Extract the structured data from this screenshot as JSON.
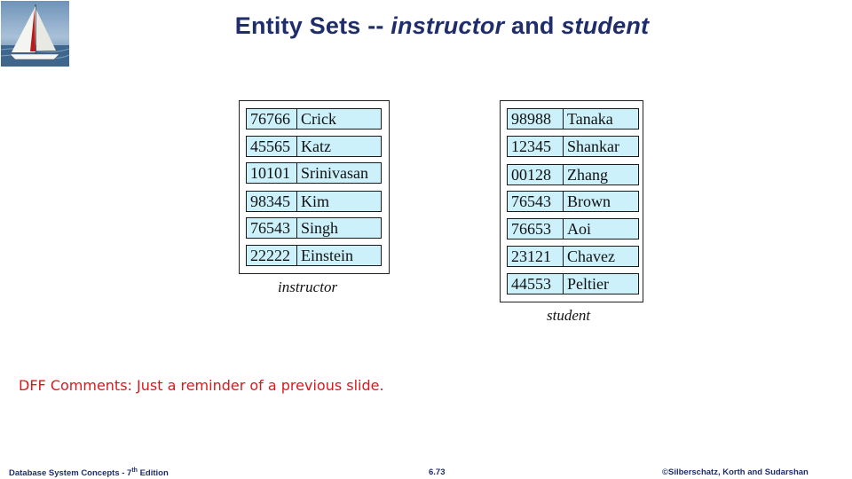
{
  "title": {
    "main": "Entity Sets --",
    "set1": "instructor",
    "and": "and",
    "set2": "student"
  },
  "instructor": {
    "caption": "instructor",
    "rows": [
      {
        "id": "76766",
        "name": "Crick"
      },
      {
        "id": "45565",
        "name": "Katz"
      },
      {
        "id": "10101",
        "name": "Srinivasan"
      },
      {
        "id": "98345",
        "name": "Kim"
      },
      {
        "id": "76543",
        "name": "Singh"
      },
      {
        "id": "22222",
        "name": "Einstein"
      }
    ]
  },
  "student": {
    "caption": "student",
    "rows": [
      {
        "id": "98988",
        "name": "Tanaka"
      },
      {
        "id": "12345",
        "name": "Shankar"
      },
      {
        "id": "00128",
        "name": "Zhang"
      },
      {
        "id": "76543",
        "name": "Brown"
      },
      {
        "id": "76653",
        "name": "Aoi"
      },
      {
        "id": "23121",
        "name": "Chavez"
      },
      {
        "id": "44553",
        "name": "Peltier"
      }
    ]
  },
  "comment": "DFF Comments: Just a reminder of a previous slide.",
  "footer": {
    "left_prefix": "Database System Concepts - 7",
    "left_sup": "th",
    "left_suffix": " Edition",
    "center": "6.73",
    "right": "©Silberschatz, Korth and Sudarshan"
  },
  "colors": {
    "title": "#1f2e6b",
    "row_fill": "#ccf1fb",
    "comment": "#d9181e"
  },
  "icons": {
    "logo": "sailboat-logo-icon"
  }
}
